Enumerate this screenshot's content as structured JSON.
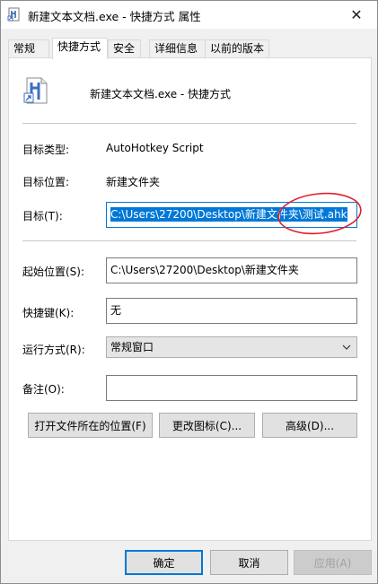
{
  "window": {
    "title": "新建文本文档.exe - 快捷方式 属性",
    "close_glyph": "✕"
  },
  "tabs": [
    {
      "label": "常规"
    },
    {
      "label": "快捷方式"
    },
    {
      "label": "安全"
    },
    {
      "label": "详细信息"
    },
    {
      "label": "以前的版本"
    }
  ],
  "header": {
    "name": "新建文本文档.exe - 快捷方式",
    "icon": "autohotkey-file-icon"
  },
  "fields": {
    "target_type_label": "目标类型:",
    "target_type_value": "AutoHotkey Script",
    "target_location_label": "目标位置:",
    "target_location_value": "新建文件夹",
    "target_label": "目标(T):",
    "target_value": "C:\\Users\\27200\\Desktop\\新建文件夹\\测试.ahk",
    "start_in_label": "起始位置(S):",
    "start_in_value": "C:\\Users\\27200\\Desktop\\新建文件夹",
    "hotkey_label": "快捷键(K):",
    "hotkey_value": "无",
    "run_label": "运行方式(R):",
    "run_value": "常规窗口",
    "comment_label": "备注(O):",
    "comment_value": ""
  },
  "actions": {
    "open_location": "打开文件所在的位置(F)",
    "change_icon": "更改图标(C)...",
    "advanced": "高级(D)..."
  },
  "footer": {
    "ok": "确定",
    "cancel": "取消",
    "apply": "应用(A)"
  },
  "colors": {
    "accent": "#0078d7",
    "annotation": "#e0202a"
  }
}
